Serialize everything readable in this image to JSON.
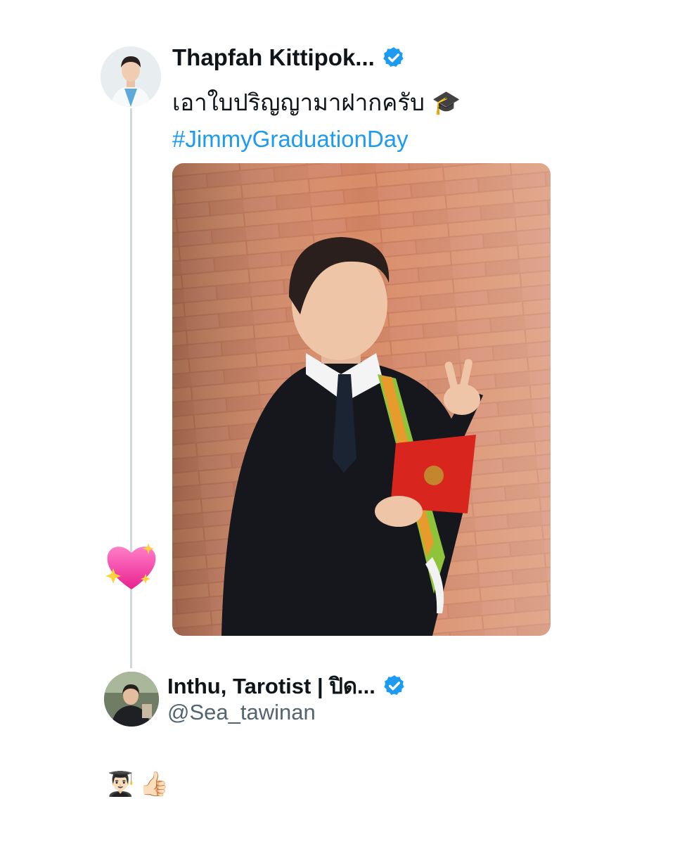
{
  "tweet": {
    "author_name": "Thapfah Kittipok...",
    "verified": true,
    "text": "เอาใบปริญญามาฝากครับ",
    "text_emoji": "🎓",
    "hashtag": "#JimmyGraduationDay"
  },
  "photo": {
    "description_icon": "graduation-photo"
  },
  "reaction": {
    "icon": "sparkling-heart-icon"
  },
  "reply": {
    "author_name": "Inthu, Tarotist | ปิด...",
    "verified": true,
    "handle": "@Sea_tawinan",
    "emojis": "👨🏻‍🎓👍🏻"
  },
  "colors": {
    "link": "#1d9bf0",
    "verified": "#1d9bf0",
    "thread_line": "#cfd9de",
    "handle": "#536471"
  }
}
